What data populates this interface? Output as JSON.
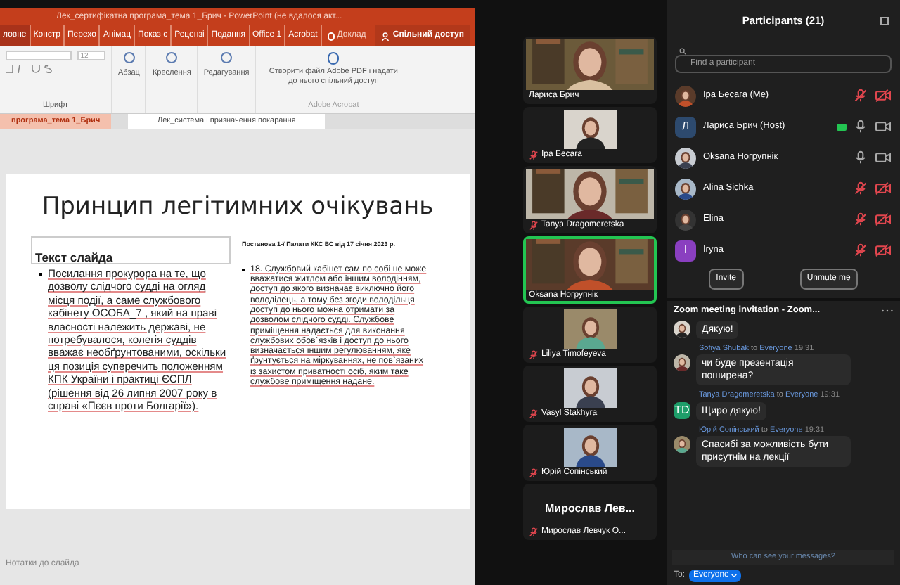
{
  "powerpoint": {
    "title": "Лек_сертифікатна програма_тема 1_Брич - PowerPoint (не вдалося акт...",
    "ribbon_tabs": [
      {
        "label": "ловне",
        "selected": true
      },
      {
        "label": "Констр",
        "selected": false
      },
      {
        "label": "Перехо",
        "selected": false
      },
      {
        "label": "Анімац",
        "selected": false
      },
      {
        "label": "Показ с",
        "selected": false
      },
      {
        "label": "Рецензі",
        "selected": false
      },
      {
        "label": "Подання",
        "selected": false
      },
      {
        "label": "Office 1",
        "selected": false
      },
      {
        "label": "Acrobat",
        "selected": false
      }
    ],
    "tell_me": "Доклад",
    "share": "Спільний доступ",
    "font_size": "12",
    "font_group": "Шрифт",
    "groups": [
      "Абзац",
      "Креслення",
      "Редагування"
    ],
    "acrobat_button": "Створити файл Adobe PDF і надати до нього спільний доступ",
    "acrobat_group": "Adobe Acrobat",
    "doc_tabs": [
      {
        "label": "програма_тема 1_Брич",
        "selected": true
      },
      {
        "label": "Лек_система і призначення покарання",
        "selected": false
      }
    ],
    "slide": {
      "title": "Принцип легітимних очікувань",
      "placeholder": "Текст слайда",
      "left_bullet": "Посилання прокурора на те, що дозволу слідчого судді на огляд місця події, а саме службового кабінету ОСОБА_7 , який на праві власності належить державі, не потребувалося, колегія суддів вважає необґрунтованими, оскільки ця позиція суперечить положенням КПК України і практиці ЄСПЛ (рішення від 26 липня 2007 року в справі «Пєєв проти Болгарії»).",
      "right_heading": "Постанова 1-ї Палати ККС ВС від 17 січня 2023 р.",
      "right_bullet": "18.  Службовий кабінет сам по собі не може вважатися житлом або іншим володінням, доступ до якого визначає виключно його володілець, а тому без згоди володільця доступ до нього можна отримати за дозволом слідчого судді. Службове приміщення надається для виконання службових обов`язків і доступ до нього визначається іншим регулюванням, яке ґрунтується на міркуваннях, не пов`язаних із захистом приватності осіб, яким таке службове приміщення надане."
    },
    "notes": "Нотатки до слайда"
  },
  "videos": [
    {
      "name": "Лариса Брич",
      "kind": "wide",
      "speaking": false,
      "muted": false
    },
    {
      "name": "Іра Бесага",
      "kind": "narrow",
      "speaking": false,
      "muted": true
    },
    {
      "name": "Tanya Dragomeretska",
      "kind": "wide",
      "speaking": false,
      "muted": true
    },
    {
      "name": "Oksana Ногрупнік",
      "kind": "wide",
      "speaking": true,
      "muted": false
    },
    {
      "name": "Liliya Timofeyeva",
      "kind": "narrow",
      "speaking": false,
      "muted": true
    },
    {
      "name": "Vasyl Stakhyra",
      "kind": "narrow",
      "speaking": false,
      "muted": true
    },
    {
      "name": "Юрій Сопінський",
      "kind": "narrow",
      "speaking": false,
      "muted": true
    },
    {
      "name": "Мирослав Левчук О...",
      "kind": "text",
      "label": "Мирослав  Лев...",
      "speaking": false,
      "muted": true
    }
  ],
  "participants": {
    "title": "Participants (21)",
    "search_placeholder": "Find a participant",
    "items": [
      {
        "name": "Іра Бесага (Me)",
        "muted": true,
        "video": false,
        "sharing": false
      },
      {
        "name": "Лариса Брич (Host)",
        "kind": "letter",
        "initial": "Л",
        "color": "#2d4a6e",
        "muted": false,
        "video": true,
        "sharing": true
      },
      {
        "name": "Oksana Ногрупнік",
        "muted": false,
        "video": true,
        "sharing": false
      },
      {
        "name": "Alina Sichka",
        "muted": true,
        "video": false,
        "sharing": false
      },
      {
        "name": "Elina",
        "muted": true,
        "video": false,
        "sharing": false
      },
      {
        "name": "Iryna",
        "kind": "letter",
        "initial": "I",
        "color": "#8a3fc0",
        "muted": true,
        "video": false,
        "sharing": false
      }
    ],
    "buttons": [
      "Invite",
      "Unmute me"
    ]
  },
  "chat": {
    "title": "Zoom meeting invitation - Zoom...",
    "messages": [
      {
        "text": "Дякую!"
      },
      {
        "sender": "Sofiya Shubak",
        "to": "to",
        "recipient": "Everyone",
        "time": "19:31",
        "text": "чи буде презентація поширена?"
      },
      {
        "sender": "Tanya Dragomeretska",
        "to": "to",
        "recipient": "Everyone",
        "time": "19:31",
        "kind": "letter",
        "initial": "TD",
        "color": "#1e9e6a",
        "text": "Щиро дякую!"
      },
      {
        "sender": "Юрій Сопінський",
        "to": "to",
        "recipient": "Everyone",
        "time": "19:31",
        "text": "Спасибі за можливість бути присутнім на лекції"
      }
    ],
    "privacy": "Who can see your messages?",
    "to_label": "To:",
    "to_value": "Everyone"
  }
}
